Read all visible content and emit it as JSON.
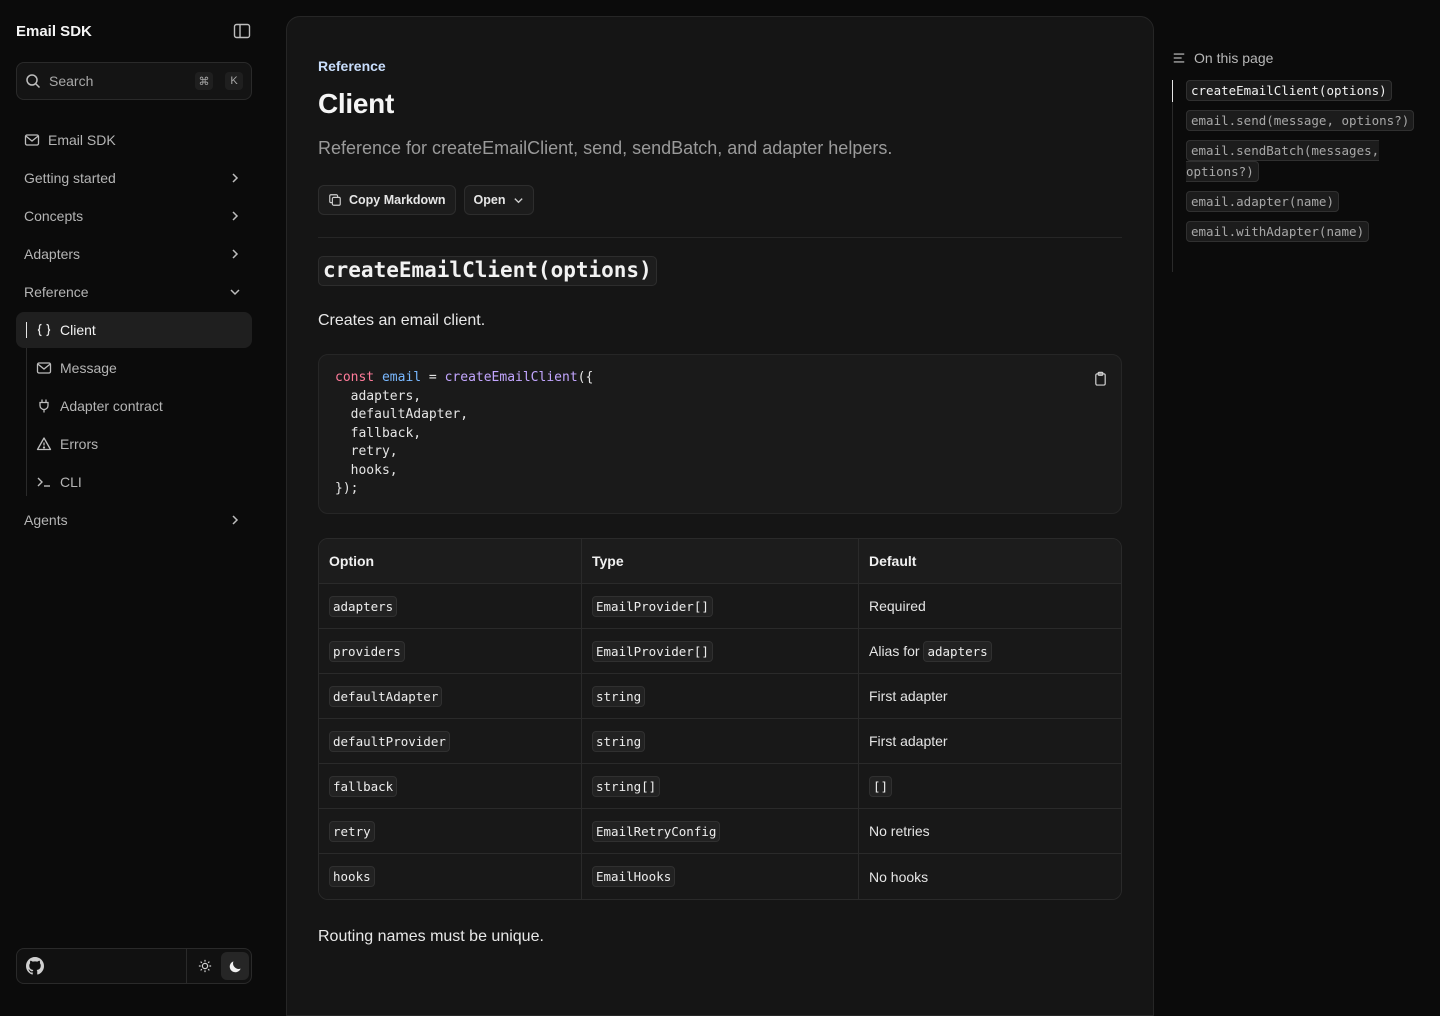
{
  "sidebar": {
    "brand": "Email SDK",
    "search": {
      "label": "Search",
      "shortcut_mod": "⌘",
      "shortcut_key": "K"
    },
    "items": [
      {
        "label": "Email SDK",
        "icon": "mail-icon"
      },
      {
        "label": "Getting started",
        "icon": "chevron-right-icon"
      },
      {
        "label": "Concepts",
        "icon": "chevron-right-icon"
      },
      {
        "label": "Adapters",
        "icon": "chevron-right-icon"
      },
      {
        "label": "Reference",
        "icon": "chevron-down-icon",
        "expanded": true
      },
      {
        "label": "Agents",
        "icon": "chevron-right-icon"
      }
    ],
    "reference_children": [
      {
        "label": "Client",
        "icon": "braces-icon",
        "active": true
      },
      {
        "label": "Message",
        "icon": "mail-icon"
      },
      {
        "label": "Adapter contract",
        "icon": "plug-icon"
      },
      {
        "label": "Errors",
        "icon": "warning-icon"
      },
      {
        "label": "CLI",
        "icon": "terminal-icon"
      }
    ]
  },
  "main": {
    "breadcrumb": "Reference",
    "title": "Client",
    "subtitle": "Reference for createEmailClient, send, sendBatch, and adapter helpers.",
    "copy_markdown": "Copy Markdown",
    "open": "Open",
    "section_title": "createEmailClient(options)",
    "section_desc": "Creates an email client.",
    "code": {
      "line1_kw": "const",
      "line1_var": "email",
      "line1_eq": " = ",
      "line1_fn": "createEmailClient",
      "line1_end": "({",
      "body": "  adapters,\n  defaultAdapter,\n  fallback,\n  retry,\n  hooks,\n});"
    },
    "table": {
      "headers": [
        "Option",
        "Type",
        "Default"
      ],
      "rows": [
        {
          "option": "adapters",
          "type": "EmailProvider[]",
          "default": "Required",
          "default_code": ""
        },
        {
          "option": "providers",
          "type": "EmailProvider[]",
          "default": "Alias for",
          "default_code": "adapters"
        },
        {
          "option": "defaultAdapter",
          "type": "string",
          "default": "First adapter",
          "default_code": ""
        },
        {
          "option": "defaultProvider",
          "type": "string",
          "default": "First adapter",
          "default_code": ""
        },
        {
          "option": "fallback",
          "type": "string[]",
          "default": "",
          "default_code": "[]"
        },
        {
          "option": "retry",
          "type": "EmailRetryConfig",
          "default": "No retries",
          "default_code": ""
        },
        {
          "option": "hooks",
          "type": "EmailHooks",
          "default": "No hooks",
          "default_code": ""
        }
      ]
    },
    "note": "Routing names must be unique."
  },
  "toc": {
    "heading": "On this page",
    "items": [
      "createEmailClient(options)",
      "email.send(message, options?)",
      "email.sendBatch(messages, options?)",
      "email.adapter(name)",
      "email.withAdapter(name)"
    ]
  },
  "colors": {
    "accent_link": "#c9defc",
    "code_keyword": "#ff7b9a",
    "code_variable": "#79b8ff",
    "code_function": "#c3a6ff"
  }
}
